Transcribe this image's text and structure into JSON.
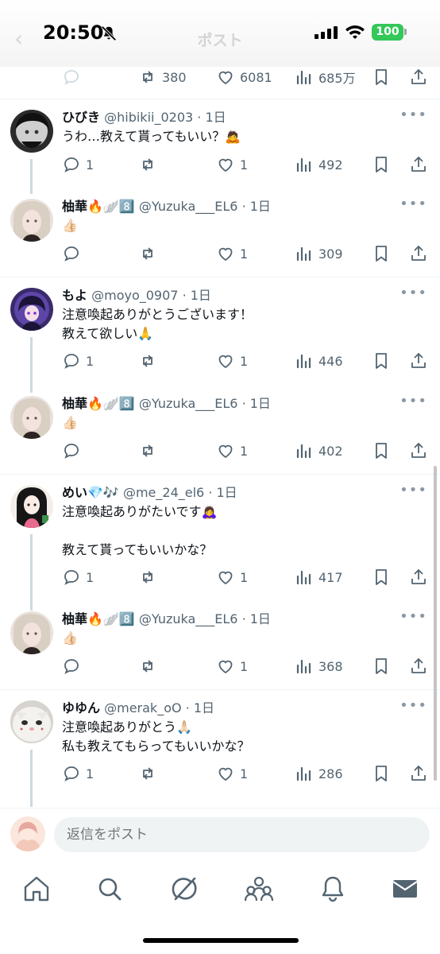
{
  "status_bar": {
    "time": "20:50",
    "battery": "100",
    "back_glyph": "‹",
    "header_title": "ポスト"
  },
  "top_partial_row": {
    "retweets": "380",
    "likes": "6081",
    "views": "685万"
  },
  "posts": [
    {
      "name": "ひびき",
      "handle": "@hibikii_0203",
      "time": "· 1日",
      "body": "うわ…教えて貰ってもいい？🙇",
      "replies": "1",
      "retweets": "",
      "likes": "1",
      "views": "492",
      "avatar": "dark-anime"
    },
    {
      "name": "柚華🔥🪽8️⃣",
      "handle": "@Yuzuka___EL6",
      "time": "· 1日",
      "body": "👍🏻",
      "replies": "",
      "retweets": "",
      "likes": "1",
      "views": "309",
      "avatar": "blonde-girl"
    },
    {
      "name": "もよ",
      "handle": "@moyo_0907",
      "time": "· 1日",
      "body": "注意喚起ありがとうございます！\n教えて欲しい🙏",
      "replies": "1",
      "retweets": "",
      "likes": "1",
      "views": "446",
      "avatar": "purple-anime"
    },
    {
      "name": "柚華🔥🪽8️⃣",
      "handle": "@Yuzuka___EL6",
      "time": "· 1日",
      "body": "👍🏻",
      "replies": "",
      "retweets": "",
      "likes": "1",
      "views": "402",
      "avatar": "blonde-girl"
    },
    {
      "name": "めい💎🎶",
      "handle": "@me_24_el6",
      "time": "· 1日",
      "body": "注意喚起ありがたいです🙇‍♀️\n\n教えて貰ってもいいかな？",
      "replies": "1",
      "retweets": "",
      "likes": "1",
      "views": "417",
      "avatar": "black-hair-anime"
    },
    {
      "name": "柚華🔥🪽8️⃣",
      "handle": "@Yuzuka___EL6",
      "time": "· 1日",
      "body": "👍🏻",
      "replies": "",
      "retweets": "",
      "likes": "1",
      "views": "368",
      "avatar": "blonde-girl"
    },
    {
      "name": "ゆゆん",
      "handle": "@merak_oO",
      "time": "· 1日",
      "body": "注意喚起ありがとう🙏🏻\n私も教えてもらってもいいかな？",
      "replies": "1",
      "retweets": "",
      "likes": "1",
      "views": "286",
      "avatar": "white-cat"
    }
  ],
  "composer": {
    "placeholder": "返信をポスト"
  },
  "tabbar": {
    "items": [
      "home-icon",
      "search-icon",
      "grok-icon",
      "communities-icon",
      "notifications-icon",
      "messages-icon"
    ]
  },
  "colors": {
    "text": "#0f1419",
    "muted": "#536471",
    "separator": "#eff3f4",
    "thread_line": "#cfd9de",
    "battery": "#34c759"
  }
}
